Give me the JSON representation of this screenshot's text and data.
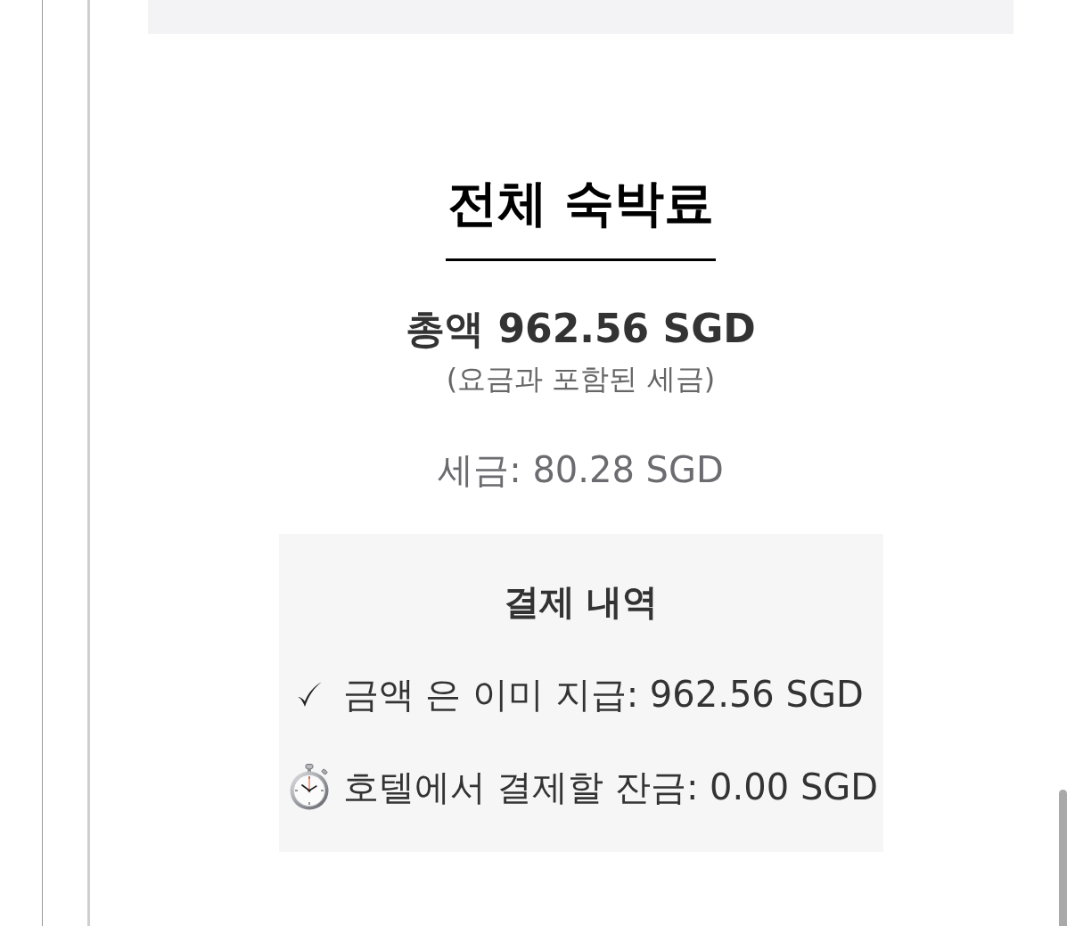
{
  "heading": "전체 숙박료",
  "total": "총액 962.56 SGD",
  "total_note": "(요금과 포함된 세금)",
  "tax": "세금: 80.28 SGD",
  "payment_details": {
    "title": "결제 내역",
    "items": [
      {
        "kind": "paid",
        "text": "금액 은 이미 지급: 962.56 SGD"
      },
      {
        "kind": "due",
        "text": "호텔에서 결제할 잔금: 0.00 SGD"
      }
    ]
  }
}
